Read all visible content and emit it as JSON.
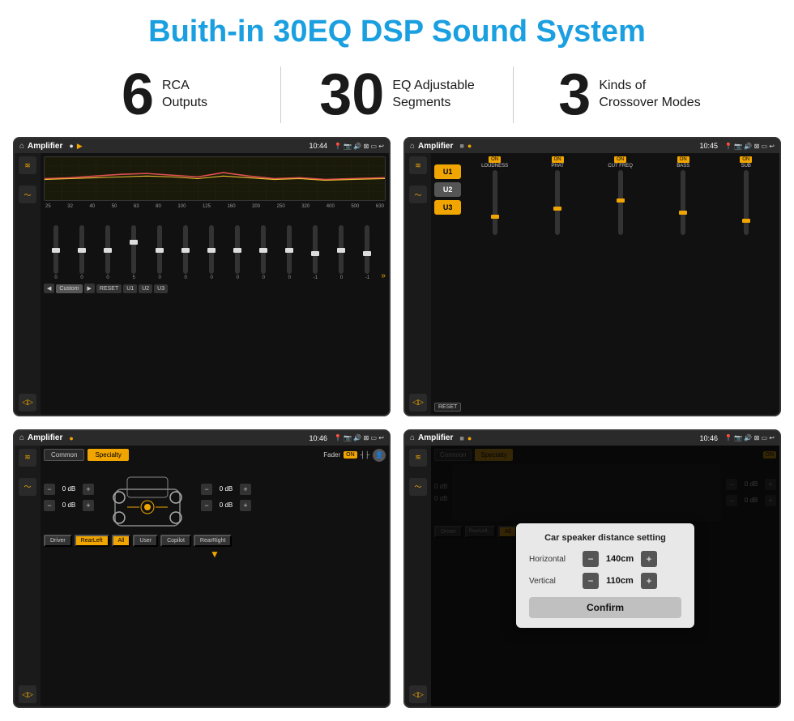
{
  "page": {
    "title": "Buith-in 30EQ DSP Sound System",
    "stats": [
      {
        "number": "6",
        "line1": "RCA",
        "line2": "Outputs"
      },
      {
        "number": "30",
        "line1": "EQ Adjustable",
        "line2": "Segments"
      },
      {
        "number": "3",
        "line1": "Kinds of",
        "line2": "Crossover Modes"
      }
    ]
  },
  "screens": {
    "s1": {
      "app": "Amplifier",
      "time": "10:44",
      "freq_labels": [
        "25",
        "32",
        "40",
        "50",
        "63",
        "80",
        "100",
        "125",
        "160",
        "200",
        "250",
        "320",
        "400",
        "500",
        "630"
      ],
      "slider_values": [
        "0",
        "0",
        "0",
        "5",
        "0",
        "0",
        "0",
        "0",
        "0",
        "0",
        "-1",
        "0",
        "-1"
      ],
      "buttons": [
        "◀",
        "Custom",
        "▶",
        "RESET",
        "U1",
        "U2",
        "U3"
      ]
    },
    "s2": {
      "app": "Amplifier",
      "time": "10:45",
      "u_buttons": [
        "U1",
        "U2",
        "U3"
      ],
      "channels": [
        {
          "on": true,
          "label": "LOUDNESS"
        },
        {
          "on": true,
          "label": "PHAT"
        },
        {
          "on": true,
          "label": "CUT FREQ"
        },
        {
          "on": true,
          "label": "BASS"
        },
        {
          "on": true,
          "label": "SUB"
        }
      ],
      "reset_label": "RESET"
    },
    "s3": {
      "app": "Amplifier",
      "time": "10:46",
      "tabs": [
        "Common",
        "Specialty"
      ],
      "fader_label": "Fader",
      "fader_on": "ON",
      "db_left_top": "0 dB",
      "db_left_bottom": "0 dB",
      "db_right_top": "0 dB",
      "db_right_bottom": "0 dB",
      "buttons": [
        "Driver",
        "RearLeft",
        "All",
        "User",
        "Copilot",
        "RearRight"
      ]
    },
    "s4": {
      "app": "Amplifier",
      "time": "10:46",
      "tabs": [
        "Common",
        "Specialty"
      ],
      "dialog": {
        "title": "Car speaker distance setting",
        "horizontal_label": "Horizontal",
        "horizontal_value": "140cm",
        "vertical_label": "Vertical",
        "vertical_value": "110cm",
        "confirm_label": "Confirm"
      },
      "buttons": [
        "Driver",
        "RearLeft",
        "All",
        "User",
        "Copilot",
        "RearRight"
      ],
      "db_right_top": "0 dB",
      "db_right_bottom": "0 dB"
    }
  },
  "icons": {
    "home": "⌂",
    "play": "▶",
    "pause": "⏸",
    "location": "📍",
    "camera": "📷",
    "volume": "🔊",
    "x_box": "⊠",
    "back": "↩",
    "eq_icon": "≋",
    "wave_icon": "〜",
    "speaker_icon": "◁▷",
    "minus": "−",
    "plus": "+"
  }
}
